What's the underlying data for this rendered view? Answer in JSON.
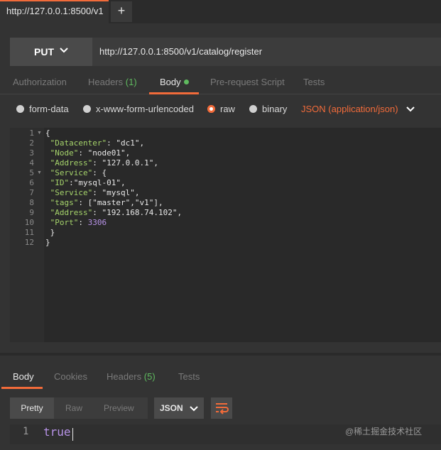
{
  "window": {
    "tab_title": "http://127.0.0.1:8500/v1",
    "new_tab_label": "+"
  },
  "request": {
    "method": "PUT",
    "url": "http://127.0.0.1:8500/v1/catalog/register"
  },
  "request_tabs": [
    {
      "label": "Authorization"
    },
    {
      "label": "Headers",
      "count": "(1)"
    },
    {
      "label": "Body",
      "active": true
    },
    {
      "label": "Pre-request Script"
    },
    {
      "label": "Tests"
    }
  ],
  "body_types": [
    {
      "label": "form-data",
      "selected": false
    },
    {
      "label": "x-www-form-urlencoded",
      "selected": false
    },
    {
      "label": "raw",
      "selected": true
    },
    {
      "label": "binary",
      "selected": false
    }
  ],
  "content_type": "JSON (application/json)",
  "code_lines": [
    {
      "n": "1",
      "text": "{"
    },
    {
      "n": "2",
      "key": "\"Datacenter\"",
      "sep": ": ",
      "val": "\"dc1\"",
      "end": ","
    },
    {
      "n": "3",
      "key": "\"Node\"",
      "sep": ": ",
      "val": "\"node01\"",
      "end": ","
    },
    {
      "n": "4",
      "key": "\"Address\"",
      "sep": ": ",
      "val": "\"127.0.0.1\"",
      "end": ","
    },
    {
      "n": "5",
      "key": "\"Service\"",
      "sep": ": ",
      "val": "{",
      "end": ""
    },
    {
      "n": "6",
      "key": "\"ID\"",
      "sep": ":",
      "val": "\"mysql-01\"",
      "end": ","
    },
    {
      "n": "7",
      "key": "\"Service\"",
      "sep": ": ",
      "val": "\"mysql\"",
      "end": ","
    },
    {
      "n": "8",
      "key": "\"tags\"",
      "sep": ": ",
      "val": "[\"master\",\"v1\"]",
      "end": ","
    },
    {
      "n": "9",
      "key": "\"Address\"",
      "sep": ": ",
      "val": "\"192.168.74.102\"",
      "end": ","
    },
    {
      "n": "10",
      "key": "\"Port\"",
      "sep": ": ",
      "num": "3306",
      "end": ""
    },
    {
      "n": "11",
      "text": " }"
    },
    {
      "n": "12",
      "text": "}"
    }
  ],
  "response_tabs": [
    {
      "label": "Body",
      "active": true
    },
    {
      "label": "Cookies"
    },
    {
      "label": "Headers",
      "count": "(5)"
    },
    {
      "label": "Tests"
    }
  ],
  "response_modes": [
    "Pretty",
    "Raw",
    "Preview"
  ],
  "response_format": "JSON",
  "response_line_number": "1",
  "response_value": "true",
  "watermark": "@稀土掘金技术社区",
  "colors": {
    "accent": "#f26b3a",
    "success": "#5fba5f",
    "number": "#b893e8",
    "key": "#a5d36a"
  },
  "icons": [
    "chevron-down-icon",
    "wrap-lines-icon",
    "fold-arrow-icon"
  ]
}
